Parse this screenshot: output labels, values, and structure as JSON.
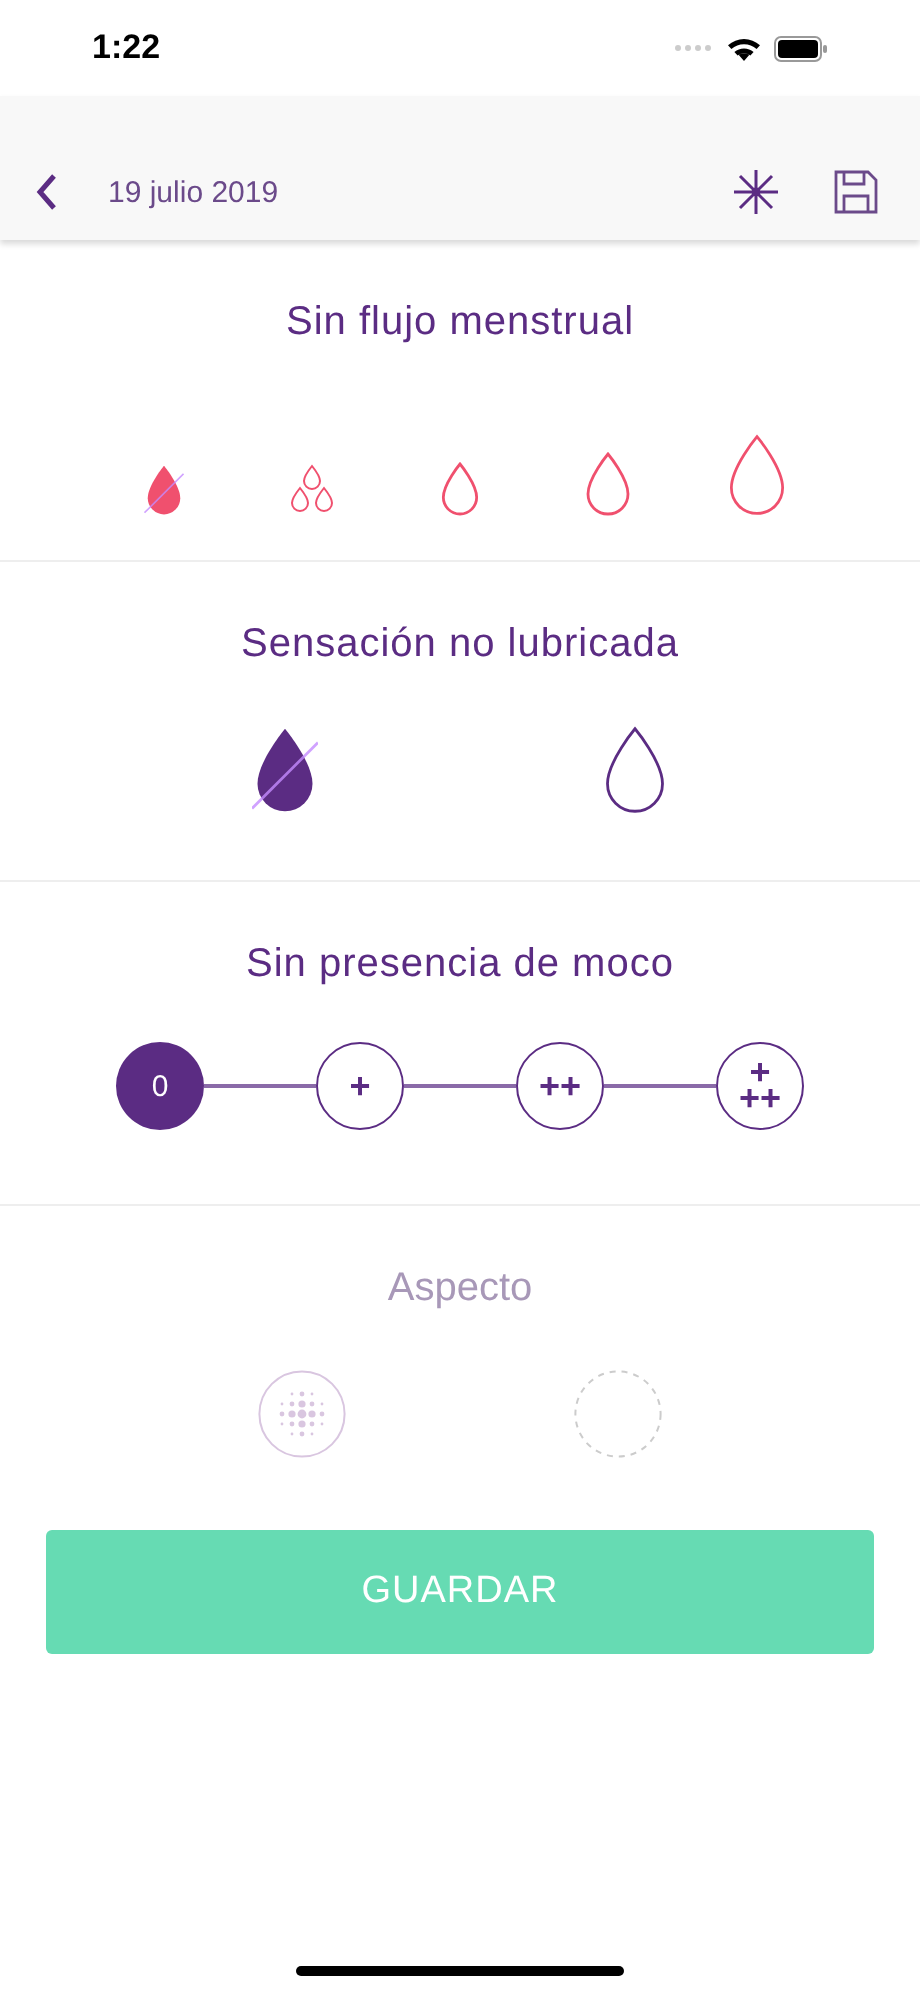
{
  "status_bar": {
    "time": "1:22"
  },
  "nav": {
    "date": "19 julio 2019"
  },
  "flow": {
    "title": "Sin flujo menstrual",
    "options": [
      {
        "kind": "none",
        "selected": true
      },
      {
        "kind": "spotting",
        "selected": false
      },
      {
        "kind": "small",
        "selected": false
      },
      {
        "kind": "medium",
        "selected": false
      },
      {
        "kind": "large",
        "selected": false
      }
    ]
  },
  "sensation": {
    "title": "Sensación no lubricada",
    "options": [
      {
        "selected": true
      },
      {
        "selected": false
      }
    ]
  },
  "mucus": {
    "title": "Sin presencia de moco",
    "steps": [
      {
        "label": "0",
        "selected": true
      },
      {
        "label": "+",
        "selected": false
      },
      {
        "label": "++",
        "selected": false
      },
      {
        "label": "+\n++",
        "selected": false
      }
    ]
  },
  "aspect": {
    "title": "Aspecto",
    "disabled": true,
    "options": [
      {
        "kind": "dotted"
      },
      {
        "kind": "empty"
      }
    ]
  },
  "save_button": {
    "label": "GUARDAR"
  }
}
